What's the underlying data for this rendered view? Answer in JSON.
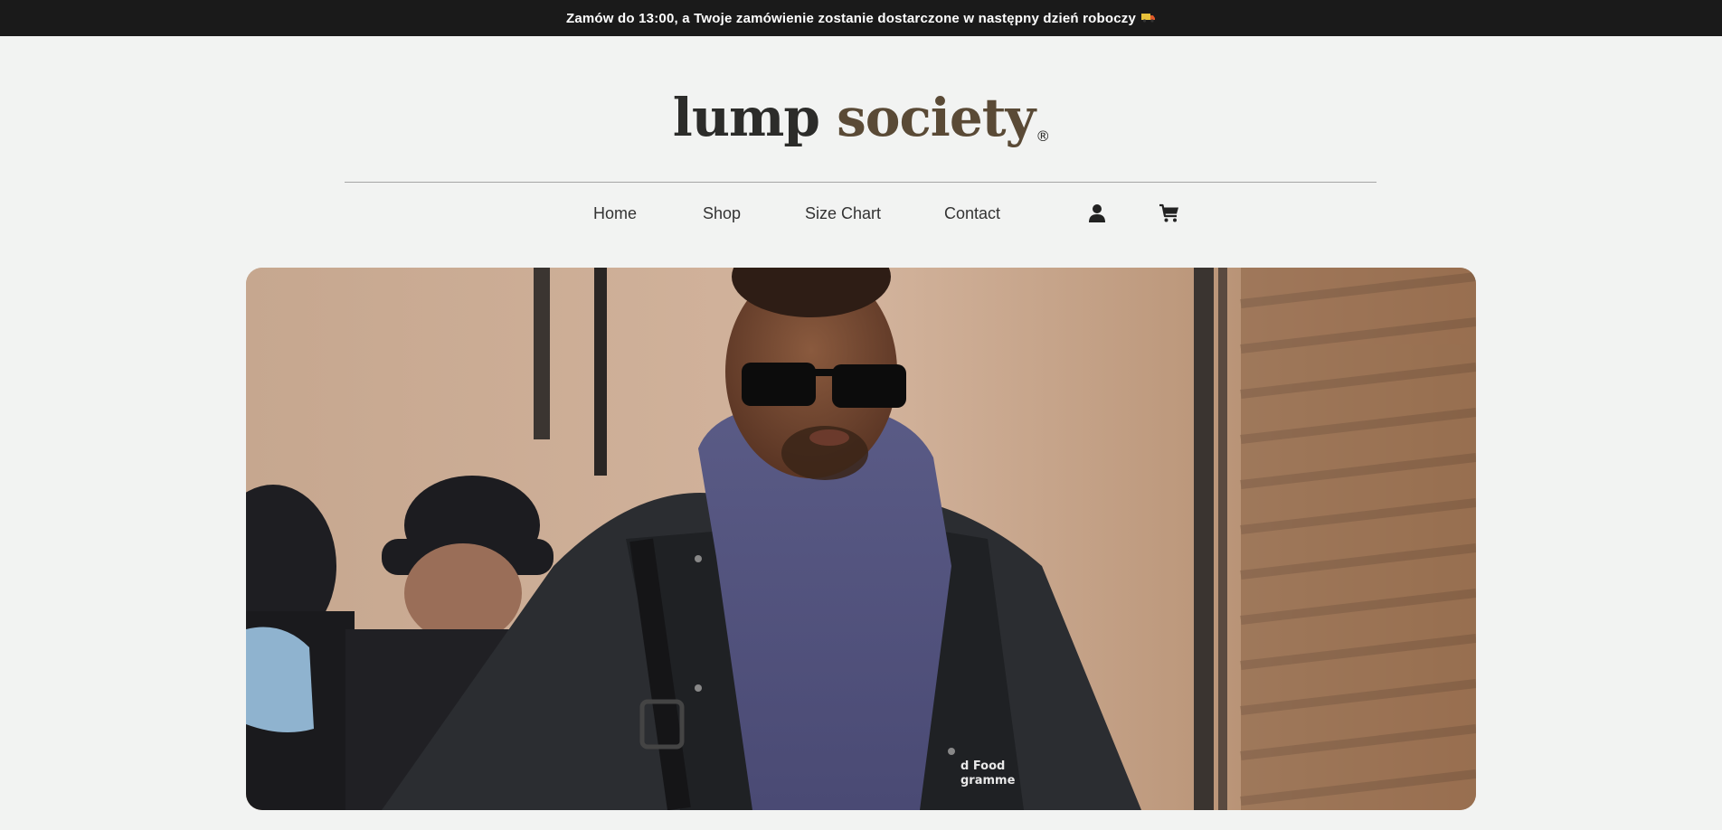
{
  "announcement": {
    "text": "Zamów do 13:00, a Twoje zamówienie zostanie dostarczone w następny dzień roboczy",
    "icon": "delivery-truck-icon"
  },
  "logo": {
    "word1": "lump",
    "word2": "society",
    "mark": "®"
  },
  "nav": {
    "items": [
      {
        "label": "Home"
      },
      {
        "label": "Shop"
      },
      {
        "label": "Size Chart"
      },
      {
        "label": "Contact"
      }
    ],
    "icons": {
      "account": "user-icon",
      "cart": "cart-icon"
    }
  },
  "colors": {
    "announcement_bg": "#1a1a1a",
    "page_bg": "#f2f3f2",
    "logo_dark": "#2c2c2a",
    "logo_brown": "#5a4a36",
    "nav_text": "#333333"
  },
  "hero": {
    "image": "hero-photo"
  }
}
